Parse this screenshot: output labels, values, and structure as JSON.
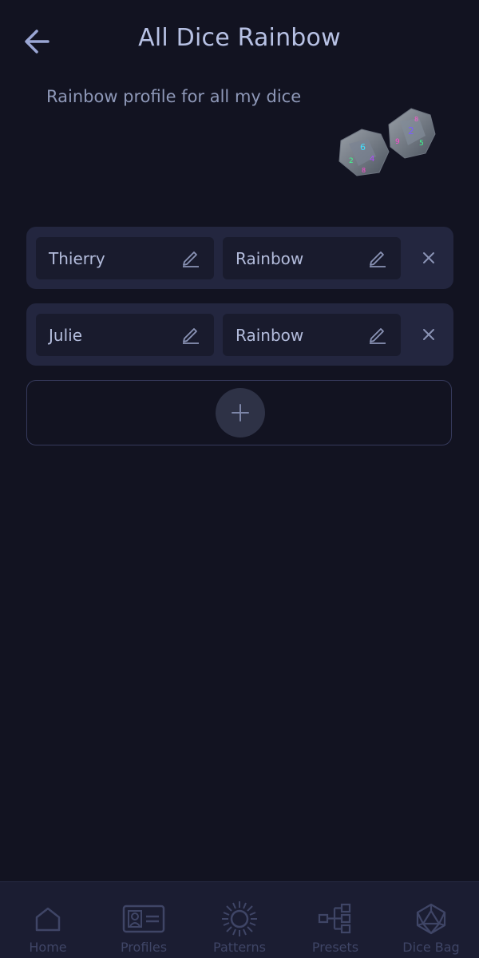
{
  "header": {
    "title": "All Dice Rainbow"
  },
  "description": "Rainbow profile for all my dice",
  "rules": [
    {
      "die": "Thierry",
      "profile": "Rainbow"
    },
    {
      "die": "Julie",
      "profile": "Rainbow"
    }
  ],
  "nav": {
    "items": [
      {
        "label": "Home",
        "icon": "home-icon"
      },
      {
        "label": "Profiles",
        "icon": "id-card-icon"
      },
      {
        "label": "Patterns",
        "icon": "sun-burst-icon"
      },
      {
        "label": "Presets",
        "icon": "hierarchy-icon"
      },
      {
        "label": "Dice Bag",
        "icon": "d20-icon"
      }
    ]
  },
  "colors": {
    "background": "#121321",
    "row_bg": "#23263f",
    "chip_bg": "#191b2d",
    "title": "#b7c1e4",
    "nav_inactive": "#3f4566"
  }
}
